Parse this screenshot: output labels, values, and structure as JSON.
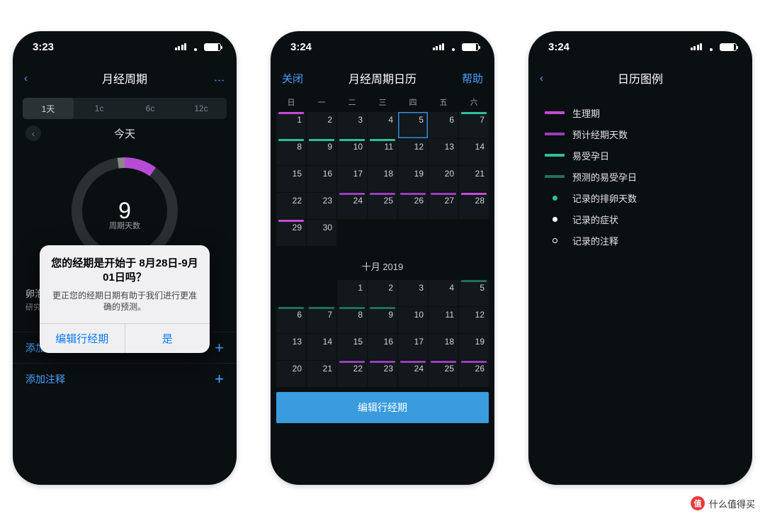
{
  "status": {
    "time1": "3:23",
    "time2": "3:24",
    "time3": "3:24"
  },
  "phone1": {
    "nav_title": "月经周期",
    "seg": [
      "1天",
      "1c",
      "6c",
      "12c"
    ],
    "today": "今天",
    "ring_num": "9",
    "ring_sub": "周期天数",
    "phase_title": "卵泡期",
    "phase_body": "研究表明……但尽量不要过度拉伸。更多",
    "add_symptom": "添加症状",
    "add_note": "添加注释",
    "popup_title": "您的经期是开始于 8月28日-9月01日吗？",
    "popup_sub": "更正您的经期日期有助于我们进行更准确的预测。",
    "popup_edit": "编辑行经期",
    "popup_yes": "是"
  },
  "phone2": {
    "close": "关闭",
    "title": "月经周期日历",
    "help": "帮助",
    "weekdays": [
      "日",
      "一",
      "二",
      "三",
      "四",
      "五",
      "六"
    ],
    "month2": "十月 2019",
    "action": "编辑行经期",
    "m1": [
      [
        {
          "n": "1",
          "b": "magenta"
        },
        {
          "n": "2"
        },
        {
          "n": "3"
        },
        {
          "n": "4"
        },
        {
          "n": "5",
          "sel": true
        },
        {
          "n": "6"
        },
        {
          "n": "7",
          "b": "teal"
        }
      ],
      [
        {
          "n": "8",
          "b": "teal"
        },
        {
          "n": "9",
          "b": "teal"
        },
        {
          "n": "10",
          "b": "teal"
        },
        {
          "n": "11",
          "b": "teal"
        },
        {
          "n": "12"
        },
        {
          "n": "13"
        },
        {
          "n": "14"
        }
      ],
      [
        {
          "n": "15"
        },
        {
          "n": "16"
        },
        {
          "n": "17"
        },
        {
          "n": "18"
        },
        {
          "n": "19"
        },
        {
          "n": "20"
        },
        {
          "n": "21"
        }
      ],
      [
        {
          "n": "22"
        },
        {
          "n": "23"
        },
        {
          "n": "24",
          "b": "mag2"
        },
        {
          "n": "25",
          "b": "mag2"
        },
        {
          "n": "26",
          "b": "mag2"
        },
        {
          "n": "27",
          "b": "mag2"
        },
        {
          "n": "28",
          "b": "magenta"
        }
      ],
      [
        {
          "n": "29",
          "b": "magenta"
        },
        {
          "n": "30"
        },
        {
          "blank": true
        },
        {
          "blank": true
        },
        {
          "blank": true
        },
        {
          "blank": true
        },
        {
          "blank": true
        }
      ]
    ],
    "m2": [
      [
        {
          "blank": true
        },
        {
          "blank": true
        },
        {
          "n": "1"
        },
        {
          "n": "2"
        },
        {
          "n": "3"
        },
        {
          "n": "4"
        },
        {
          "n": "5",
          "b": "teal2"
        }
      ],
      [
        {
          "n": "6",
          "b": "teal2"
        },
        {
          "n": "7",
          "b": "teal2"
        },
        {
          "n": "8",
          "b": "teal2"
        },
        {
          "n": "9",
          "b": "teal2"
        },
        {
          "n": "10"
        },
        {
          "n": "11"
        },
        {
          "n": "12"
        }
      ],
      [
        {
          "n": "13"
        },
        {
          "n": "14"
        },
        {
          "n": "15"
        },
        {
          "n": "16"
        },
        {
          "n": "17"
        },
        {
          "n": "18"
        },
        {
          "n": "19"
        }
      ],
      [
        {
          "n": "20"
        },
        {
          "n": "21"
        },
        {
          "n": "22",
          "b": "mag2"
        },
        {
          "n": "23",
          "b": "mag2"
        },
        {
          "n": "24",
          "b": "mag2"
        },
        {
          "n": "25",
          "b": "mag2"
        },
        {
          "n": "26",
          "b": "mag2"
        }
      ]
    ]
  },
  "phone3": {
    "title": "日历图例",
    "legend": [
      {
        "kind": "line",
        "color": "#c44bd9",
        "label": "生理期"
      },
      {
        "kind": "line",
        "color": "#9b3ebb",
        "label": "预计经期天数"
      },
      {
        "kind": "line",
        "color": "#2dbf9c",
        "label": "易受孕日"
      },
      {
        "kind": "line",
        "color": "#1f6f5c",
        "label": "预测的易受孕日"
      },
      {
        "kind": "dot-fill",
        "label": "记录的排卵天数"
      },
      {
        "kind": "dot-white",
        "label": "记录的症状"
      },
      {
        "kind": "dot-ring",
        "label": "记录的注释"
      }
    ]
  },
  "watermark": "什么值得买"
}
